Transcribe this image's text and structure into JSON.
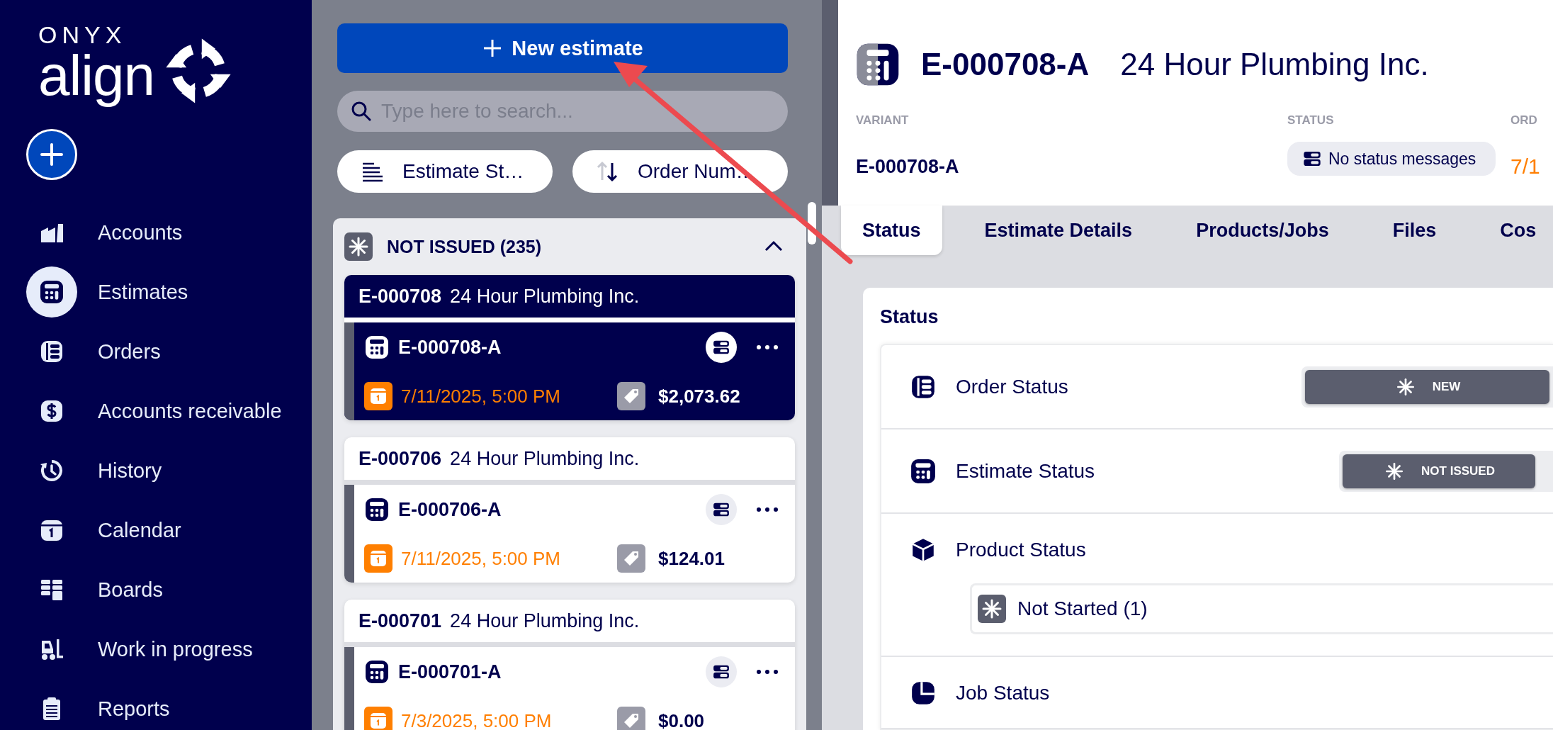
{
  "sidebar": {
    "logo": {
      "brand": "ONYX",
      "product": "align"
    },
    "items": [
      {
        "label": "Accounts",
        "selected": false
      },
      {
        "label": "Estimates",
        "selected": true
      },
      {
        "label": "Orders",
        "selected": false
      },
      {
        "label": "Accounts receivable",
        "selected": false
      },
      {
        "label": "History",
        "selected": false
      },
      {
        "label": "Calendar",
        "selected": false
      },
      {
        "label": "Boards",
        "selected": false
      },
      {
        "label": "Work in progress",
        "selected": false
      },
      {
        "label": "Reports",
        "selected": false
      }
    ]
  },
  "list_panel": {
    "new_button": "New estimate",
    "search": {
      "placeholder": "Type here to search..."
    },
    "filters": [
      {
        "kind": "filter",
        "label": "Estimate St…"
      },
      {
        "kind": "sort",
        "label": "Order Num…"
      }
    ],
    "group": {
      "title": "NOT ISSUED (235)",
      "expanded": true,
      "estimates": [
        {
          "number": "E-000708",
          "account": "24 Hour Plumbing Inc.",
          "selected": true,
          "variant": "E-000708-A",
          "due_date": "7/11/2025, 5:00 PM",
          "amount": "$2,073.62"
        },
        {
          "number": "E-000706",
          "account": "24 Hour Plumbing Inc.",
          "selected": false,
          "variant": "E-000706-A",
          "due_date": "7/11/2025, 5:00 PM",
          "amount": "$124.01"
        },
        {
          "number": "E-000701",
          "account": "24 Hour Plumbing Inc.",
          "selected": false,
          "variant": "E-000701-A",
          "due_date": "7/3/2025, 5:00 PM",
          "amount": "$0.00"
        }
      ]
    }
  },
  "detail": {
    "number": "E-000708-A",
    "account": "24 Hour Plumbing Inc.",
    "fields": [
      {
        "kind": "text",
        "label": "VARIANT",
        "value": "E-000708-A"
      },
      {
        "kind": "pill",
        "label": "STATUS",
        "value": "No status messages"
      },
      {
        "kind": "date",
        "label": "ORD",
        "value": "7/1"
      }
    ],
    "tabs": [
      {
        "label": "Status",
        "selected": true
      },
      {
        "label": "Estimate Details",
        "selected": false
      },
      {
        "label": "Products/Jobs",
        "selected": false
      },
      {
        "label": "Files",
        "selected": false
      },
      {
        "label": "Cos",
        "selected": false
      }
    ],
    "status_card": {
      "title": "Status",
      "rows": [
        {
          "kind": "badge",
          "label": "Order Status",
          "badge": "NEW"
        },
        {
          "kind": "badge",
          "label": "Estimate Status",
          "badge": "NOT ISSUED"
        },
        {
          "kind": "list",
          "label": "Product Status",
          "items": [
            "Not Started (1)"
          ]
        },
        {
          "kind": "list",
          "label": "Job Status"
        }
      ]
    }
  }
}
